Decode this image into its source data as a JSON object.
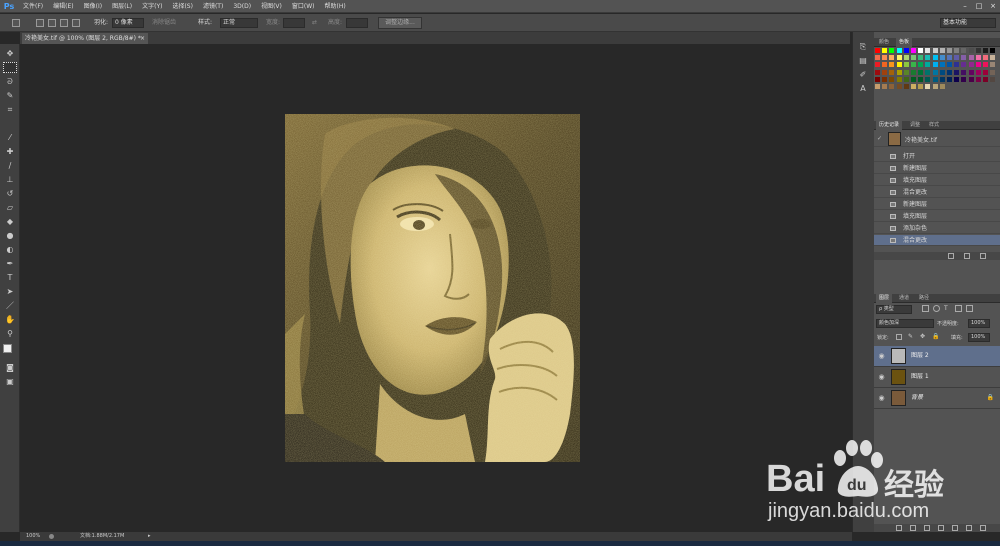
{
  "menu": {
    "logo": "Ps",
    "items": [
      "文件(F)",
      "编辑(E)",
      "图像(I)",
      "图层(L)",
      "文字(Y)",
      "选择(S)",
      "滤镜(T)",
      "3D(D)",
      "视图(V)",
      "窗口(W)",
      "帮助(H)"
    ]
  },
  "options": {
    "feather_label": "羽化:",
    "feather_value": "0 像素",
    "antialias": "消除锯齿",
    "style_label": "样式:",
    "style_value": "正常",
    "width_label": "宽度:",
    "height_label": "高度:",
    "refine_edge": "调整边缘...",
    "workspace": "基本功能"
  },
  "document": {
    "tab_title": "冷艳美女.tif @ 100% (图层 2, RGB/8#) *",
    "close": "×",
    "zoom": "100%",
    "doc_info": "文档:1.88M/2.17M"
  },
  "swatches_panel": {
    "tabs": [
      "颜色",
      "色板"
    ],
    "colors": [
      "#ff0000",
      "#ffff00",
      "#00ff00",
      "#00ffff",
      "#0000ff",
      "#ff00ff",
      "#ffffff",
      "#e6e6e6",
      "#cccccc",
      "#b3b3b3",
      "#999999",
      "#808080",
      "#666666",
      "#4d4d4d",
      "#333333",
      "#1a1a1a",
      "#000000",
      "#f26c4f",
      "#f68e55",
      "#fbaf5c",
      "#fff467",
      "#acd372",
      "#7cc576",
      "#3bb878",
      "#1abbb4",
      "#00bff3",
      "#438ccb",
      "#5574b9",
      "#605ca8",
      "#855fa8",
      "#a763a8",
      "#f06ea9",
      "#f26d7d",
      "#c7b299",
      "#ed1c24",
      "#f26522",
      "#f7941d",
      "#fff200",
      "#8dc63f",
      "#39b54a",
      "#00a651",
      "#00a99d",
      "#00aeef",
      "#0072bc",
      "#0054a6",
      "#2e3192",
      "#662d91",
      "#92278f",
      "#ec008c",
      "#ed145b",
      "#998675",
      "#9e0b0f",
      "#a0410d",
      "#a36209",
      "#aba000",
      "#598527",
      "#1a7b30",
      "#007236",
      "#00746b",
      "#0076a3",
      "#004b80",
      "#003471",
      "#1b1464",
      "#440e62",
      "#630460",
      "#9e005d",
      "#9e0039",
      "#736357",
      "#790000",
      "#7b2e00",
      "#7d4900",
      "#827b00",
      "#406618",
      "#005e20",
      "#005826",
      "#005952",
      "#005b7f",
      "#003663",
      "#002157",
      "#0d004c",
      "#32004b",
      "#4b0049",
      "#7b0046",
      "#7a0026",
      "#534741",
      "#c69c6d",
      "#a67c52",
      "#8c6239",
      "#754c24",
      "#603913",
      "#ccae62",
      "#b39b4f",
      "#e3d6b2",
      "#b8a67c",
      "#9e8a5c"
    ]
  },
  "history_panel": {
    "tabs": [
      "历史记录",
      "调整",
      "样式"
    ],
    "snapshot": "冷艳美女.tif",
    "steps": [
      "打开",
      "新建图层",
      "填充图层",
      "混合更改",
      "新建图层",
      "填充图层",
      "添加杂色",
      "混合更改"
    ]
  },
  "layers_panel": {
    "tabs": [
      "图层",
      "通道",
      "路径"
    ],
    "filter_label": "ρ 类型",
    "blend_mode": "颜色加深",
    "opacity_label": "不透明度:",
    "opacity_value": "100%",
    "lock_label": "锁定:",
    "fill_label": "填充:",
    "fill_value": "100%",
    "layers": [
      {
        "name": "图层 2",
        "thumb": "#b9b9b9"
      },
      {
        "name": "图层 1",
        "thumb": "#6b5210"
      },
      {
        "name": "背景",
        "thumb": "#7a5a3a"
      }
    ]
  },
  "watermark": {
    "brand_main": "Bai",
    "brand_mid": "du",
    "brand_cn": "经验",
    "url": "jingyan.baidu.com"
  },
  "colors": {
    "selected_row": "#5f6f8c",
    "sepia_dark": "#201a08",
    "sepia_light": "#e8d49a"
  }
}
